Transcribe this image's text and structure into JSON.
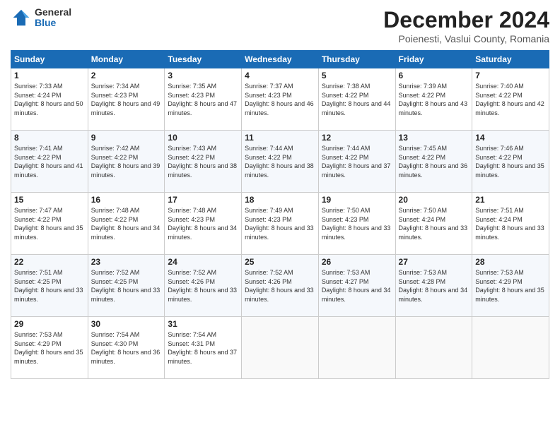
{
  "logo": {
    "general": "General",
    "blue": "Blue"
  },
  "header": {
    "month": "December 2024",
    "location": "Poienesti, Vaslui County, Romania"
  },
  "weekdays": [
    "Sunday",
    "Monday",
    "Tuesday",
    "Wednesday",
    "Thursday",
    "Friday",
    "Saturday"
  ],
  "weeks": [
    [
      {
        "day": "1",
        "sunrise": "7:33 AM",
        "sunset": "4:24 PM",
        "daylight": "8 hours and 50 minutes."
      },
      {
        "day": "2",
        "sunrise": "7:34 AM",
        "sunset": "4:23 PM",
        "daylight": "8 hours and 49 minutes."
      },
      {
        "day": "3",
        "sunrise": "7:35 AM",
        "sunset": "4:23 PM",
        "daylight": "8 hours and 47 minutes."
      },
      {
        "day": "4",
        "sunrise": "7:37 AM",
        "sunset": "4:23 PM",
        "daylight": "8 hours and 46 minutes."
      },
      {
        "day": "5",
        "sunrise": "7:38 AM",
        "sunset": "4:22 PM",
        "daylight": "8 hours and 44 minutes."
      },
      {
        "day": "6",
        "sunrise": "7:39 AM",
        "sunset": "4:22 PM",
        "daylight": "8 hours and 43 minutes."
      },
      {
        "day": "7",
        "sunrise": "7:40 AM",
        "sunset": "4:22 PM",
        "daylight": "8 hours and 42 minutes."
      }
    ],
    [
      {
        "day": "8",
        "sunrise": "7:41 AM",
        "sunset": "4:22 PM",
        "daylight": "8 hours and 41 minutes."
      },
      {
        "day": "9",
        "sunrise": "7:42 AM",
        "sunset": "4:22 PM",
        "daylight": "8 hours and 39 minutes."
      },
      {
        "day": "10",
        "sunrise": "7:43 AM",
        "sunset": "4:22 PM",
        "daylight": "8 hours and 38 minutes."
      },
      {
        "day": "11",
        "sunrise": "7:44 AM",
        "sunset": "4:22 PM",
        "daylight": "8 hours and 38 minutes."
      },
      {
        "day": "12",
        "sunrise": "7:44 AM",
        "sunset": "4:22 PM",
        "daylight": "8 hours and 37 minutes."
      },
      {
        "day": "13",
        "sunrise": "7:45 AM",
        "sunset": "4:22 PM",
        "daylight": "8 hours and 36 minutes."
      },
      {
        "day": "14",
        "sunrise": "7:46 AM",
        "sunset": "4:22 PM",
        "daylight": "8 hours and 35 minutes."
      }
    ],
    [
      {
        "day": "15",
        "sunrise": "7:47 AM",
        "sunset": "4:22 PM",
        "daylight": "8 hours and 35 minutes."
      },
      {
        "day": "16",
        "sunrise": "7:48 AM",
        "sunset": "4:22 PM",
        "daylight": "8 hours and 34 minutes."
      },
      {
        "day": "17",
        "sunrise": "7:48 AM",
        "sunset": "4:23 PM",
        "daylight": "8 hours and 34 minutes."
      },
      {
        "day": "18",
        "sunrise": "7:49 AM",
        "sunset": "4:23 PM",
        "daylight": "8 hours and 33 minutes."
      },
      {
        "day": "19",
        "sunrise": "7:50 AM",
        "sunset": "4:23 PM",
        "daylight": "8 hours and 33 minutes."
      },
      {
        "day": "20",
        "sunrise": "7:50 AM",
        "sunset": "4:24 PM",
        "daylight": "8 hours and 33 minutes."
      },
      {
        "day": "21",
        "sunrise": "7:51 AM",
        "sunset": "4:24 PM",
        "daylight": "8 hours and 33 minutes."
      }
    ],
    [
      {
        "day": "22",
        "sunrise": "7:51 AM",
        "sunset": "4:25 PM",
        "daylight": "8 hours and 33 minutes."
      },
      {
        "day": "23",
        "sunrise": "7:52 AM",
        "sunset": "4:25 PM",
        "daylight": "8 hours and 33 minutes."
      },
      {
        "day": "24",
        "sunrise": "7:52 AM",
        "sunset": "4:26 PM",
        "daylight": "8 hours and 33 minutes."
      },
      {
        "day": "25",
        "sunrise": "7:52 AM",
        "sunset": "4:26 PM",
        "daylight": "8 hours and 33 minutes."
      },
      {
        "day": "26",
        "sunrise": "7:53 AM",
        "sunset": "4:27 PM",
        "daylight": "8 hours and 34 minutes."
      },
      {
        "day": "27",
        "sunrise": "7:53 AM",
        "sunset": "4:28 PM",
        "daylight": "8 hours and 34 minutes."
      },
      {
        "day": "28",
        "sunrise": "7:53 AM",
        "sunset": "4:29 PM",
        "daylight": "8 hours and 35 minutes."
      }
    ],
    [
      {
        "day": "29",
        "sunrise": "7:53 AM",
        "sunset": "4:29 PM",
        "daylight": "8 hours and 35 minutes."
      },
      {
        "day": "30",
        "sunrise": "7:54 AM",
        "sunset": "4:30 PM",
        "daylight": "8 hours and 36 minutes."
      },
      {
        "day": "31",
        "sunrise": "7:54 AM",
        "sunset": "4:31 PM",
        "daylight": "8 hours and 37 minutes."
      },
      null,
      null,
      null,
      null
    ]
  ]
}
